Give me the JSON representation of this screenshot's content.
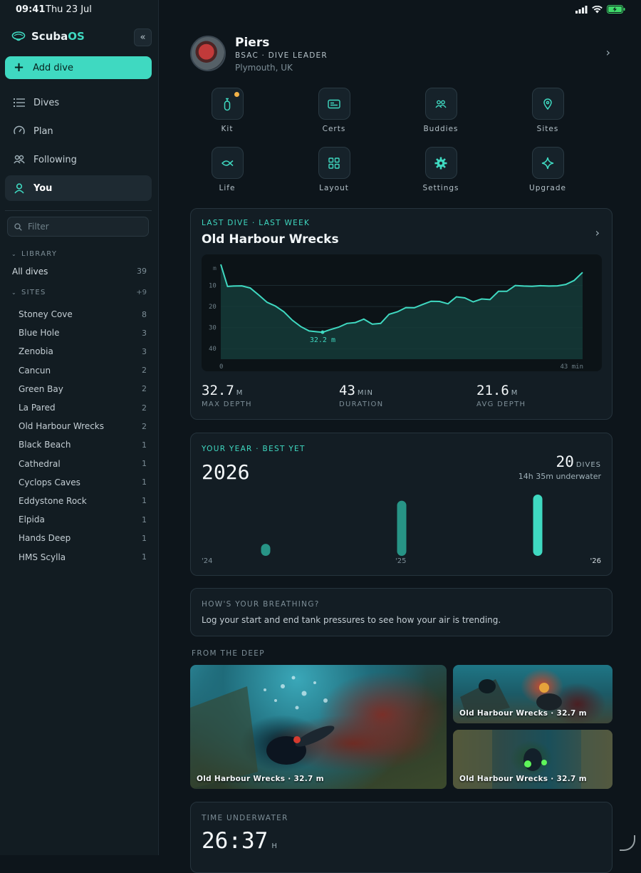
{
  "status": {
    "time": "09:41",
    "date": "Thu 23 Jul"
  },
  "app": {
    "name_main": "Scuba",
    "name_accent": "OS",
    "collapse_icon": "chevrons-left-icon"
  },
  "sidebar": {
    "add_label": "Add dive",
    "nav": [
      {
        "label": "Dives",
        "icon": "list-icon"
      },
      {
        "label": "Plan",
        "icon": "gauge-icon"
      },
      {
        "label": "Following",
        "icon": "people-icon"
      },
      {
        "label": "You",
        "icon": "person-icon",
        "active": true
      }
    ],
    "filter_placeholder": "Filter",
    "library_head": "LIBRARY",
    "all_dives": {
      "label": "All dives",
      "count": "39"
    },
    "sites_head": "SITES",
    "sites_more": "+9",
    "sites": [
      {
        "name": "Stoney Cove",
        "count": "8"
      },
      {
        "name": "Blue Hole",
        "count": "3"
      },
      {
        "name": "Zenobia",
        "count": "3"
      },
      {
        "name": "Cancun",
        "count": "2"
      },
      {
        "name": "Green Bay",
        "count": "2"
      },
      {
        "name": "La Pared",
        "count": "2"
      },
      {
        "name": "Old Harbour Wrecks",
        "count": "2"
      },
      {
        "name": "Black Beach",
        "count": "1"
      },
      {
        "name": "Cathedral",
        "count": "1"
      },
      {
        "name": "Cyclops Caves",
        "count": "1"
      },
      {
        "name": "Eddystone Rock",
        "count": "1"
      },
      {
        "name": "Elpida",
        "count": "1"
      },
      {
        "name": "Hands Deep",
        "count": "1"
      },
      {
        "name": "HMS Scylla",
        "count": "1"
      }
    ]
  },
  "profile": {
    "name": "Piers",
    "role": "BSAC · DIVE LEADER",
    "location": "Plymouth, UK"
  },
  "tiles": [
    {
      "label": "Kit",
      "icon": "tank-icon",
      "badge": true
    },
    {
      "label": "Certs",
      "icon": "card-icon"
    },
    {
      "label": "Buddies",
      "icon": "people-icon"
    },
    {
      "label": "Sites",
      "icon": "pin-icon"
    },
    {
      "label": "Life",
      "icon": "fish-icon"
    },
    {
      "label": "Layout",
      "icon": "grid-icon"
    },
    {
      "label": "Settings",
      "icon": "gear-icon"
    },
    {
      "label": "Upgrade",
      "icon": "sparkle-icon"
    }
  ],
  "last_dive": {
    "eyebrow": "LAST DIVE · LAST WEEK",
    "title": "Old Harbour Wrecks",
    "stats": [
      {
        "value": "32.7",
        "unit": "M",
        "label": "MAX DEPTH"
      },
      {
        "value": "43",
        "unit": "MIN",
        "label": "DURATION"
      },
      {
        "value": "21.6",
        "unit": "M",
        "label": "AVG DEPTH"
      }
    ]
  },
  "chart_data": {
    "type": "area",
    "title": "",
    "x_unit_label_start": "0",
    "x_unit_label_end": "43 min",
    "y_unit_label": "m",
    "y_ticks": [
      "10",
      "20",
      "30",
      "40"
    ],
    "ylim": [
      0,
      45
    ],
    "xlim": [
      0,
      43
    ],
    "annotation": "32.2 m",
    "annotation_point": [
      12.1,
      32.2
    ],
    "x": [
      0,
      0.8,
      1.5,
      2.5,
      3.5,
      4.5,
      5.5,
      6.5,
      7.5,
      8.5,
      9.5,
      10.5,
      11.5,
      12.1,
      13,
      14,
      15,
      16,
      17,
      18,
      19,
      20,
      21,
      22,
      23,
      24,
      25,
      26,
      27,
      28,
      29,
      30,
      31,
      32,
      33,
      34,
      35,
      36,
      37,
      38,
      39,
      40,
      41,
      42,
      43
    ],
    "values": [
      0,
      10.5,
      10.3,
      10.2,
      11.2,
      14.5,
      18,
      19.8,
      22.5,
      26.5,
      29.5,
      31.6,
      32,
      32.2,
      31,
      29.8,
      28,
      27.6,
      26,
      28.4,
      28,
      23.7,
      22.5,
      20.5,
      20.6,
      19,
      17.5,
      17.6,
      18.7,
      15.4,
      15.9,
      17.8,
      16.4,
      16.7,
      12.8,
      12.8,
      10,
      10.3,
      10.4,
      10.1,
      10.3,
      10.2,
      9.5,
      7.6,
      3.8
    ],
    "grid": true
  },
  "your_year": {
    "eyebrow": "YOUR YEAR · BEST YET",
    "year": "2026",
    "dives": "20",
    "dives_unit": "DIVES",
    "underwater": "14h 35m underwater",
    "axis": [
      "'24",
      "'25",
      "'26"
    ],
    "bars": [
      1,
      9,
      10
    ]
  },
  "breathing": {
    "eyebrow": "HOW'S YOUR BREATHING?",
    "text": "Log your start and end tank pressures to see how your air is trending."
  },
  "from_deep": {
    "head": "FROM THE DEEP",
    "photos": [
      {
        "caption": "Old Harbour Wrecks · 32.7 m"
      },
      {
        "caption": "Old Harbour Wrecks · 32.7 m"
      },
      {
        "caption": "Old Harbour Wrecks · 32.7 m"
      }
    ]
  },
  "time_underwater": {
    "eyebrow": "TIME UNDERWATER",
    "hours": "26",
    "minutes": "37",
    "unit": "H"
  },
  "colors": {
    "accent": "#3fd9c1",
    "badge": "#f2b247",
    "bg": "#0d151b"
  }
}
